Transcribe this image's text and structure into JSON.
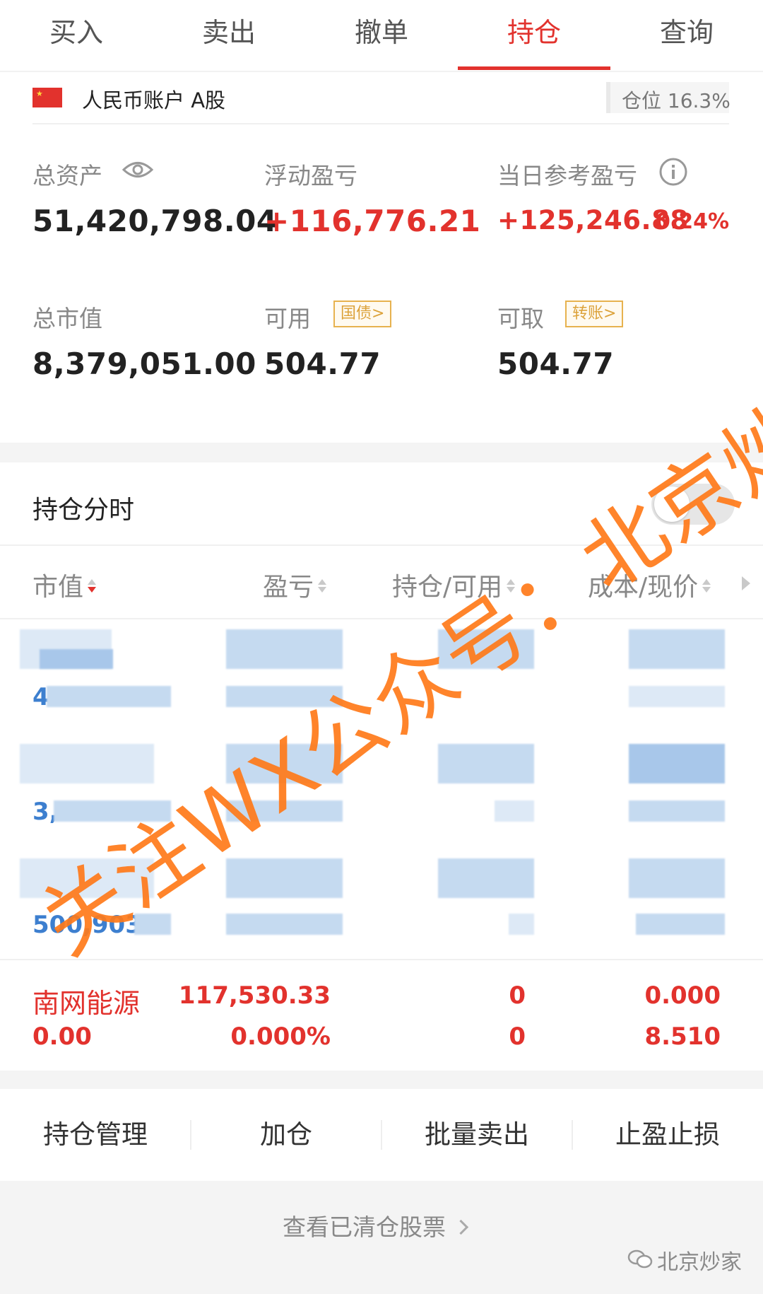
{
  "tabs": [
    "买入",
    "卖出",
    "撤单",
    "持仓",
    "查询"
  ],
  "active_tab": "持仓",
  "account": {
    "label": "人民币账户 A股",
    "position_ratio": "仓位 16.3%"
  },
  "metrics": {
    "total_assets_label": "总资产",
    "total_assets": "51,420,798.04",
    "floating_pl_label": "浮动盈亏",
    "floating_pl": "+116,776.21",
    "daily_pl_label": "当日参考盈亏",
    "daily_pl": "+125,246.88",
    "daily_pl_pct": "0.24%",
    "market_value_label": "总市值",
    "market_value": "8,379,051.00",
    "available_label": "可用",
    "available_tag": "国债>",
    "available": "504.77",
    "withdrawable_label": "可取",
    "withdrawable_tag": "转账>",
    "withdrawable": "504.77"
  },
  "intraday": {
    "label": "持仓分时",
    "enabled": false
  },
  "table": {
    "headers": [
      "市值",
      "盈亏",
      "持仓/可用",
      "成本/现价"
    ],
    "blurred_rows": [
      {
        "value_prefix": "4"
      },
      {
        "value_prefix": "3,"
      },
      {
        "value_prefix": "500,903."
      }
    ],
    "holding": {
      "name": "南网能源",
      "market_value": "0.00",
      "pl": "117,530.33",
      "pl_pct": "0.000%",
      "position": "0",
      "available": "0",
      "cost": "0.000",
      "price": "8.510"
    }
  },
  "actions": [
    "持仓管理",
    "加仓",
    "批量卖出",
    "止盈止损"
  ],
  "cleared_link": "查看已清仓股票",
  "watermark": "关注WX公众号：北京炒家",
  "source_mark": "北京炒家",
  "colors": {
    "accent": "#e2322d",
    "tag": "#dca23a",
    "link_blue": "#3d7fcf",
    "watermark": "#ff7a1a"
  }
}
